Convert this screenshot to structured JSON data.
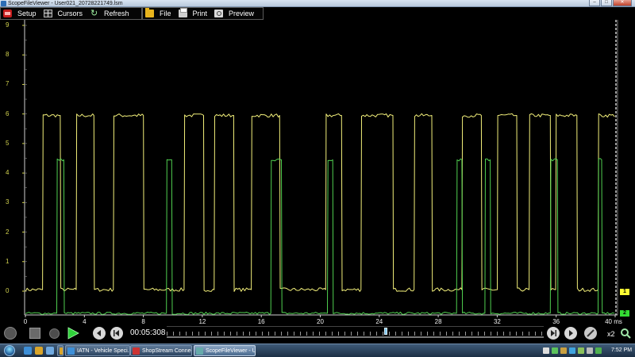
{
  "window": {
    "title": "ScopeFileViewer - User021_20728221749.lsm",
    "controls": {
      "minimize": "–",
      "maximize": "□",
      "close": "✕"
    }
  },
  "toolbar": {
    "setup": {
      "label": "Setup",
      "icon": "setup-icon"
    },
    "cursors": {
      "label": "Cursors",
      "icon": "cursors-icon"
    },
    "refresh": {
      "label": "Refresh",
      "icon": "refresh-icon"
    },
    "file": {
      "label": "File",
      "icon": "folder-icon"
    },
    "print": {
      "label": "Print",
      "icon": "printer-icon"
    },
    "preview": {
      "label": "Preview",
      "icon": "print-preview-icon"
    }
  },
  "channels": [
    {
      "id": "1",
      "color": "#f2ef7a"
    },
    {
      "id": "2",
      "color": "#50d050"
    }
  ],
  "colors": {
    "trace_1": "#f2ef7a",
    "trace_2": "#50d050",
    "y_axis_labels": "#d2d24e",
    "marker_1_bg": "#ffff33",
    "marker_2_bg": "#33dd33"
  },
  "chart_data": {
    "type": "line",
    "title": "",
    "xlabel": "",
    "ylabel": "",
    "x_unit": "ms",
    "xlim": [
      0,
      40
    ],
    "ylim": [
      0,
      9
    ],
    "x_ticks": [
      "0",
      "4",
      "8",
      "12",
      "16",
      "20",
      "24",
      "28",
      "32",
      "36",
      "40 ms"
    ],
    "y_ticks": [
      "0",
      "1",
      "2",
      "3",
      "4",
      "5",
      "6",
      "7",
      "8",
      "9"
    ],
    "grid": false,
    "series": [
      {
        "channel": "1",
        "low": 0.05,
        "high": 5.95,
        "high_intervals_ms": [
          [
            1.2,
            2.3
          ],
          [
            3.4,
            4.6
          ],
          [
            5.9,
            8.0
          ],
          [
            10.7,
            12.0
          ],
          [
            12.8,
            14.1
          ],
          [
            15.3,
            17.2
          ],
          [
            20.3,
            21.4
          ],
          [
            22.8,
            24.9
          ],
          [
            26.3,
            27.6
          ],
          [
            29.6,
            30.9
          ],
          [
            32.0,
            33.3
          ],
          [
            34.2,
            35.6
          ],
          [
            36.0,
            37.4
          ],
          [
            38.8,
            40.0
          ]
        ]
      },
      {
        "channel": "2",
        "low": -0.75,
        "high": 4.45,
        "high_intervals_ms": [
          [
            2.1,
            2.6
          ],
          [
            9.5,
            9.9
          ],
          [
            16.6,
            17.3
          ],
          [
            20.5,
            20.8
          ],
          [
            29.2,
            29.6
          ],
          [
            31.2,
            31.5
          ],
          [
            35.6,
            36.1
          ],
          [
            38.8,
            39.1
          ]
        ]
      }
    ]
  },
  "playback": {
    "time": "00:05:308",
    "zoom": "x2",
    "position_fraction": 0.58
  },
  "taskbar": {
    "tasks": [
      {
        "label": "",
        "icon": "folder-icon"
      },
      {
        "label": "IATN - Vehicle Speci...",
        "icon": "browser-icon"
      },
      {
        "label": "ShopStream Connect",
        "icon": "app-icon"
      },
      {
        "label": "ScopeFileViewer - U...",
        "icon": "scope-icon"
      }
    ],
    "clock": "7:52 PM"
  }
}
